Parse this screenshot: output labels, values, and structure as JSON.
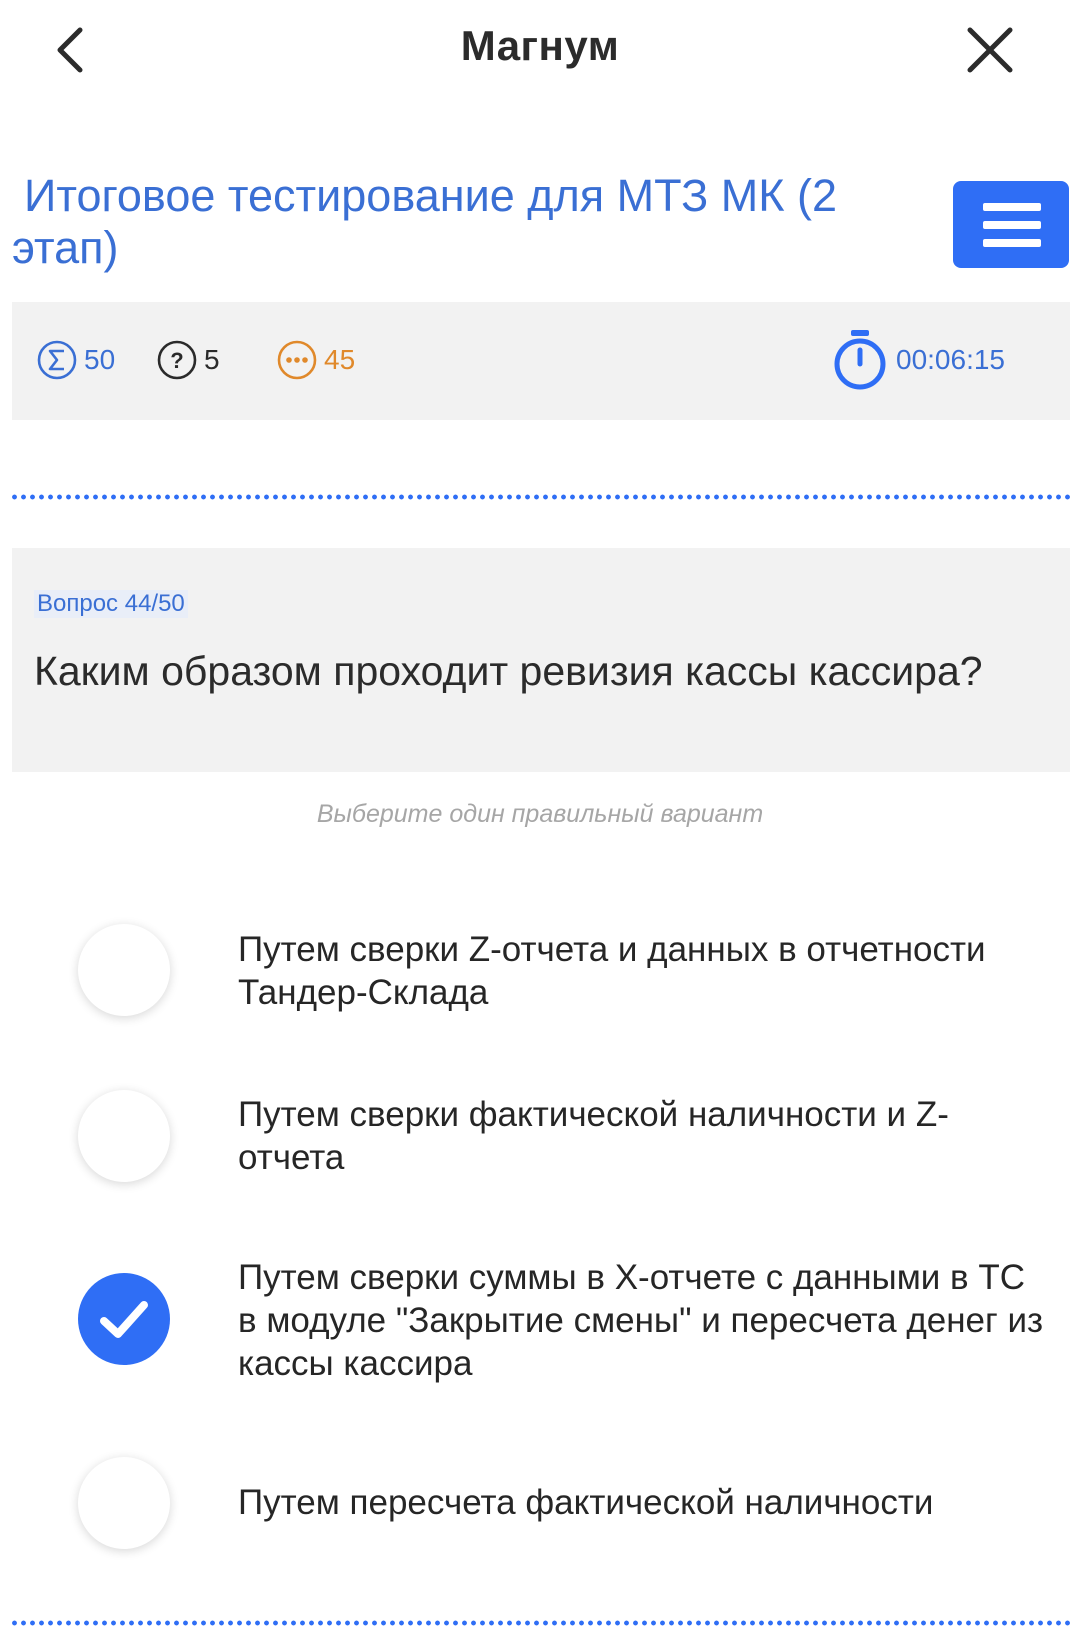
{
  "header": {
    "title": "Магнум",
    "back_icon": "chevron-left-icon",
    "close_icon": "close-icon"
  },
  "test": {
    "title": "Итоговое тестирование для МТЗ МК (2 этап)",
    "menu_icon": "hamburger-menu-icon"
  },
  "stats": {
    "total": "50",
    "questions": "5",
    "remaining": "45",
    "timer": "00:06:15"
  },
  "question": {
    "number_label": "Вопрос 44/50",
    "text": "Каким образом проходит ревизия кассы кассира?"
  },
  "hint": "Выберите один правильный вариант",
  "options": [
    {
      "label": "Путем сверки Z-отчета и данных в отчетности Тандер-Склада",
      "selected": false
    },
    {
      "label": "Путем сверки фактической наличности и Z-отчета",
      "selected": false
    },
    {
      "label": "Путем сверки суммы в Х-отчете с данными в ТС в модуле \"Закрытие смены\" и пересчета денег из кассы кассира",
      "selected": true
    },
    {
      "label": "Путем пересчета фактической наличности",
      "selected": false
    }
  ],
  "colors": {
    "accent": "#2f6ef5",
    "title_blue": "#3a6fd4",
    "orange": "#e0892b",
    "panel_bg": "#f2f2f2"
  }
}
